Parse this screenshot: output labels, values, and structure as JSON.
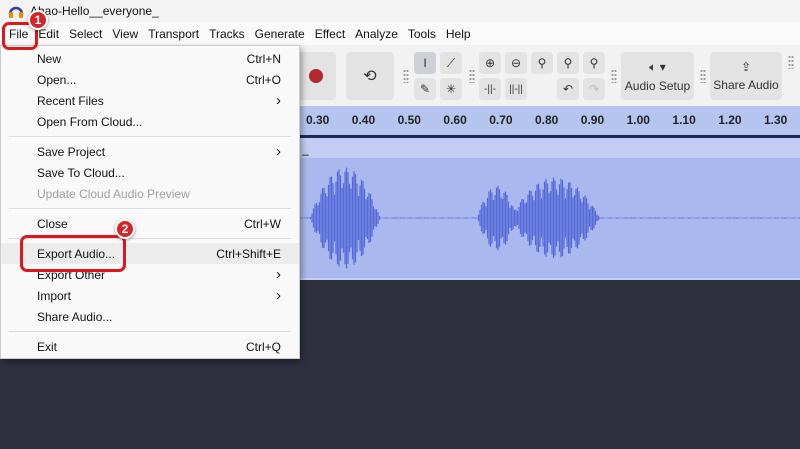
{
  "window": {
    "title": "Ahao-Hello__everyone_",
    "app_icon": "headphones-icon"
  },
  "menubar": [
    "File",
    "Edit",
    "Select",
    "View",
    "Transport",
    "Tracks",
    "Generate",
    "Effect",
    "Analyze",
    "Tools",
    "Help"
  ],
  "toolbar": {
    "audio_setup": "Audio Setup",
    "share_audio": "Share Audio"
  },
  "ruler": [
    "0.30",
    "0.40",
    "0.50",
    "0.60",
    "0.70",
    "0.80",
    "0.90",
    "1.00",
    "1.10",
    "1.20",
    "1.30"
  ],
  "track": {
    "name_fragment": "_"
  },
  "file_menu": {
    "groups": [
      [
        {
          "label": "New",
          "shortcut": "Ctrl+N"
        },
        {
          "label": "Open...",
          "shortcut": "Ctrl+O"
        },
        {
          "label": "Recent Files",
          "submenu": true
        },
        {
          "label": "Open From Cloud..."
        }
      ],
      [
        {
          "label": "Save Project",
          "submenu": true
        },
        {
          "label": "Save To Cloud..."
        },
        {
          "label": "Update Cloud Audio Preview",
          "disabled": true
        }
      ],
      [
        {
          "label": "Close",
          "shortcut": "Ctrl+W"
        }
      ],
      [
        {
          "label": "Export Audio...",
          "shortcut": "Ctrl+Shift+E",
          "highlighted": true
        },
        {
          "label": "Export Other",
          "submenu": true
        },
        {
          "label": "Import",
          "submenu": true
        },
        {
          "label": "Share Audio..."
        }
      ],
      [
        {
          "label": "Exit",
          "shortcut": "Ctrl+Q"
        }
      ]
    ]
  },
  "annotations": {
    "step1": "1",
    "step2": "2"
  },
  "colors": {
    "accent": "#e0161e",
    "waveform": "#5468d8",
    "track_bg": "#a9b8ee",
    "record": "#b3282d"
  }
}
